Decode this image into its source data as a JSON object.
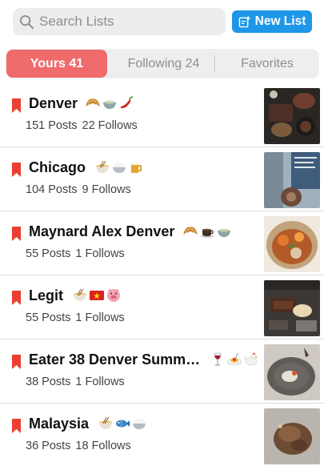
{
  "search": {
    "placeholder": "Search Lists"
  },
  "toolbar": {
    "new_list_label": "New List"
  },
  "tabs": [
    {
      "label": "Yours 41",
      "active": true
    },
    {
      "label": "Following 24",
      "active": false
    },
    {
      "label": "Favorites",
      "active": false
    }
  ],
  "colors": {
    "accent": "#1e97e8",
    "active_tab": "#f06b6c",
    "bookmark": "#ea3f32"
  },
  "lists": [
    {
      "title": "Denver",
      "posts": "151 Posts",
      "follows": "22 Follows",
      "emojis": [
        "croissant-icon",
        "bowl-icon",
        "chili-pepper-icon"
      ]
    },
    {
      "title": "Chicago",
      "posts": "104 Posts",
      "follows": "9 Follows",
      "emojis": [
        "noodles-icon",
        "rice-bowl-icon",
        "beer-mug-icon"
      ]
    },
    {
      "title": "Maynard Alex Denver",
      "posts": "55 Posts",
      "follows": "1 Follows",
      "emojis": [
        "croissant-icon",
        "coffee-icon",
        "bowl-icon"
      ]
    },
    {
      "title": "Legit",
      "posts": "55 Posts",
      "follows": "1 Follows",
      "emojis": [
        "noodles-icon",
        "vietnam-flag-icon",
        "pig-face-icon"
      ]
    },
    {
      "title": "Eater 38 Denver Summ…",
      "posts": "38 Posts",
      "follows": "1 Follows",
      "emojis": [
        "wine-glass-icon",
        "spaghetti-icon",
        "rooster-icon"
      ]
    },
    {
      "title": "Malaysia",
      "posts": "36 Posts",
      "follows": "18 Follows",
      "emojis": [
        "noodles-icon",
        "fish-icon",
        "rice-bowl-icon"
      ]
    }
  ]
}
